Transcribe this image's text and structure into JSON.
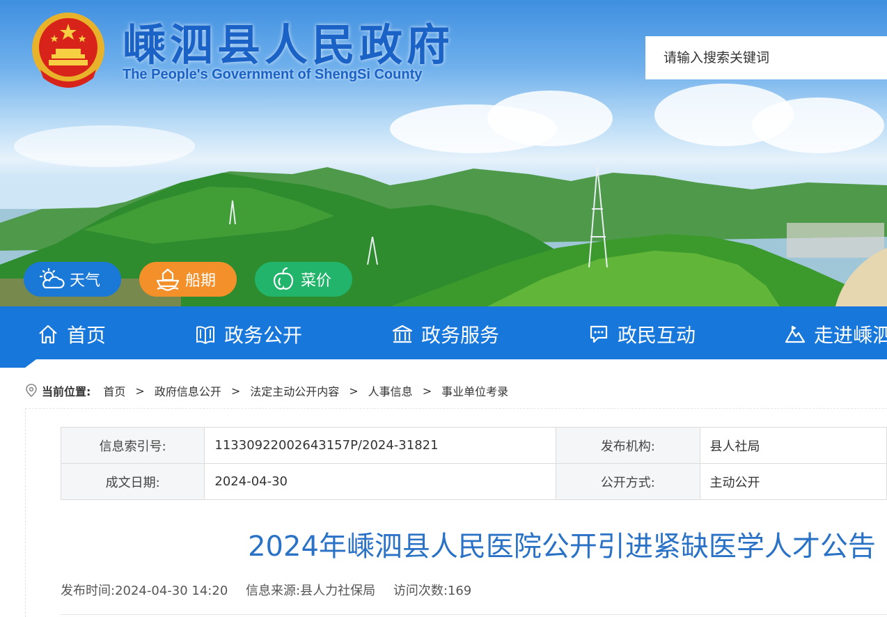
{
  "site": {
    "title": "嵊泗县人民政府",
    "subtitle": "The People's Government of ShengSi County"
  },
  "search": {
    "placeholder": "请输入搜索关键词"
  },
  "quick_links": [
    {
      "label": "天气",
      "icon": "weather-icon",
      "color": "#1a78d6"
    },
    {
      "label": "船期",
      "icon": "ship-icon",
      "color": "#f3902a"
    },
    {
      "label": "菜价",
      "icon": "vegetable-icon",
      "color": "#21b46a"
    }
  ],
  "nav": {
    "color": "#1777db",
    "items": [
      {
        "label": "首页",
        "icon": "home-icon"
      },
      {
        "label": "政务公开",
        "icon": "book-icon"
      },
      {
        "label": "政务服务",
        "icon": "building-icon"
      },
      {
        "label": "政民互动",
        "icon": "chat-icon"
      },
      {
        "label": "走进嵊泗",
        "icon": "mountain-icon"
      }
    ]
  },
  "breadcrumb": {
    "label": "当前位置:",
    "items": [
      "首页",
      "政府信息公开",
      "法定主动公开内容",
      "人事信息",
      "事业单位考录"
    ],
    "separator": ">"
  },
  "info": {
    "index_label": "信息索引号:",
    "index_value": "11330922002643157P/2024-31821",
    "publisher_label": "发布机构:",
    "publisher_value": "县人社局",
    "date_label": "成文日期:",
    "date_value": "2024-04-30",
    "method_label": "公开方式:",
    "method_value": "主动公开"
  },
  "article": {
    "title": "2024年嵊泗县人民医院公开引进紧缺医学人才公告",
    "publish_time": "发布时间:2024-04-30 14:20",
    "source": "信息来源:县人力社保局",
    "visits": "访问次数:169"
  }
}
